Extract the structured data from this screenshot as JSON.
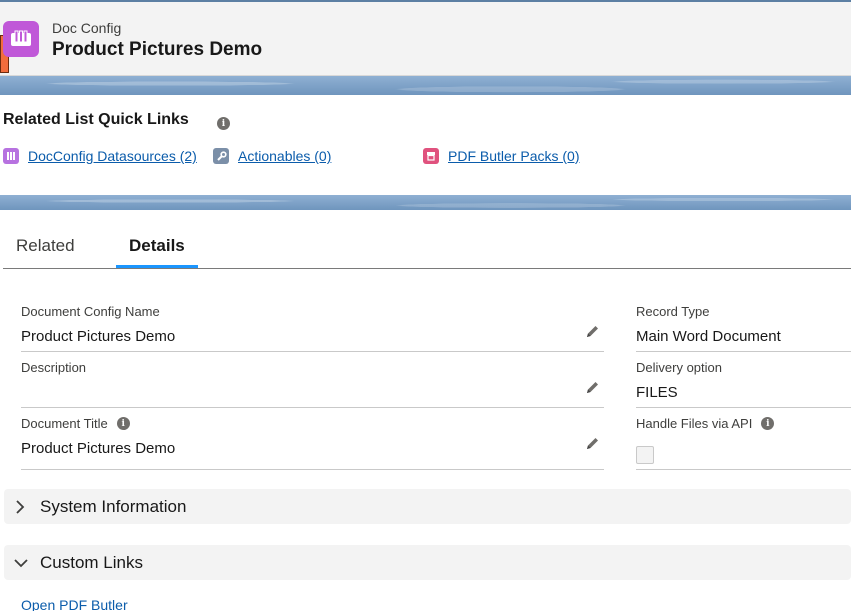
{
  "header": {
    "object_label": "Doc Config",
    "record_title": "Product Pictures Demo",
    "icon": "book-icon",
    "icon_color": "#c058d8"
  },
  "quick_links": {
    "title": "Related List Quick Links",
    "links": [
      {
        "label": "DocConfig Datasources (2)",
        "icon": "datasource-icon",
        "color": "#b772e0"
      },
      {
        "label": "Actionables (0)",
        "icon": "wrench-icon",
        "color": "#7b8fa8"
      },
      {
        "label": "PDF Butler Packs (0)",
        "icon": "package-icon",
        "color": "#e0527e"
      }
    ]
  },
  "tabs": [
    {
      "label": "Related",
      "active": false
    },
    {
      "label": "Details",
      "active": true
    }
  ],
  "fields": {
    "document_config_name": {
      "label": "Document Config Name",
      "value": "Product Pictures Demo"
    },
    "description": {
      "label": "Description",
      "value": ""
    },
    "document_title": {
      "label": "Document Title",
      "value": "Product Pictures Demo"
    },
    "record_type": {
      "label": "Record Type",
      "value": "Main Word Document"
    },
    "delivery_option": {
      "label": "Delivery option",
      "value": "FILES"
    },
    "handle_files_via_api": {
      "label": "Handle Files via API",
      "checked": false
    }
  },
  "sections": {
    "system_information": {
      "title": "System Information",
      "expanded": false
    },
    "custom_links": {
      "title": "Custom Links",
      "expanded": true
    }
  },
  "custom_links": {
    "open_pdf_butler": "Open PDF Butler"
  },
  "colors": {
    "link": "#0b5cab",
    "tab_active": "#1b96ff",
    "header_bg": "#f3f3f3"
  }
}
